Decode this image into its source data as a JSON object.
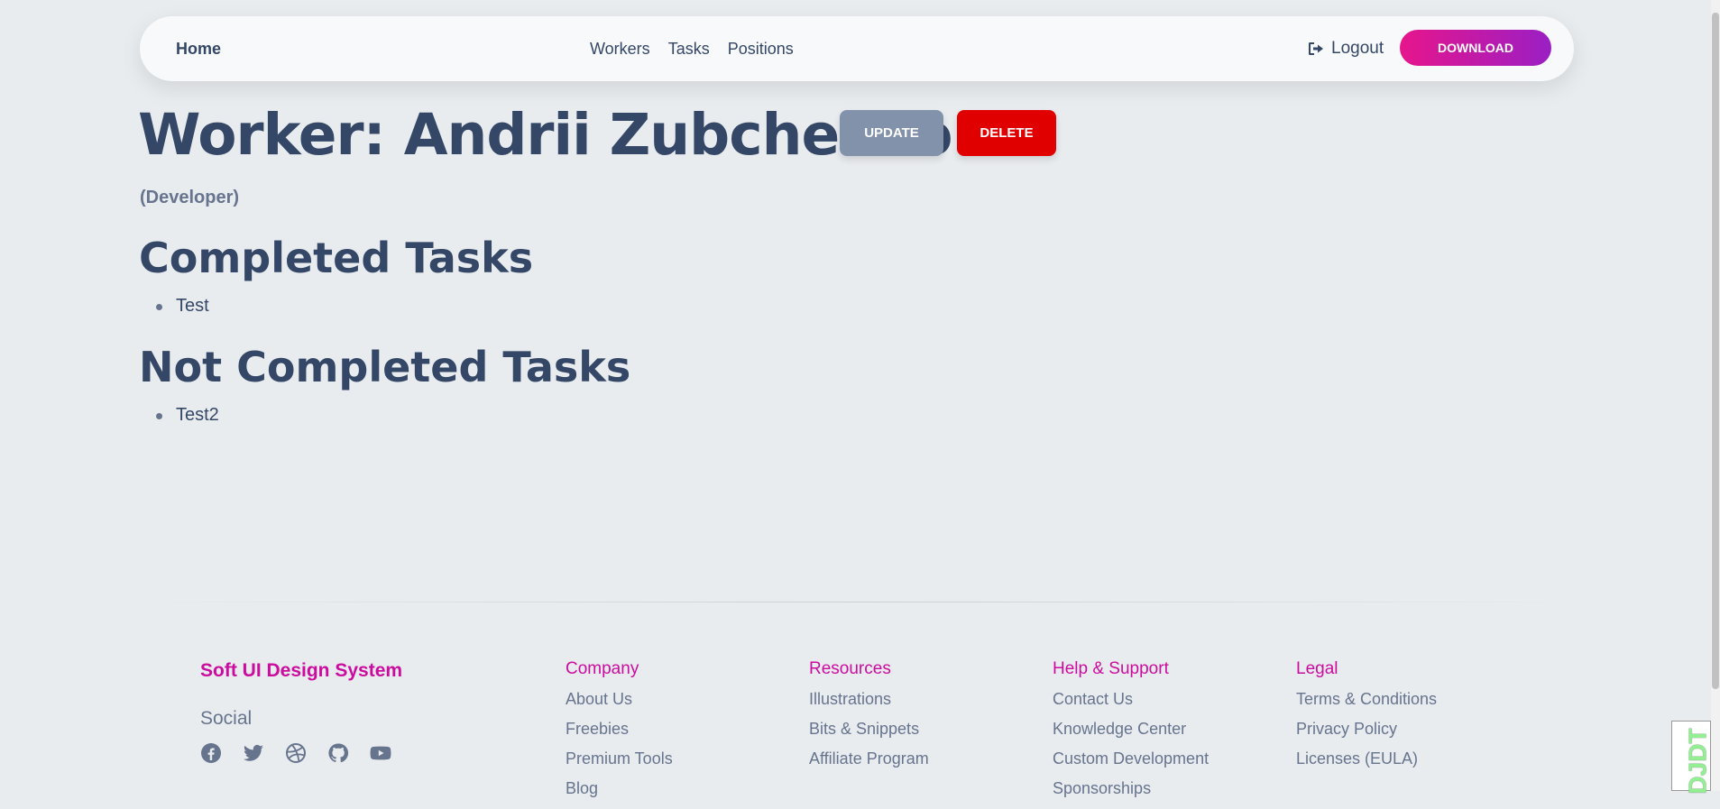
{
  "nav": {
    "brand": "Home",
    "links": [
      "Workers",
      "Tasks",
      "Positions"
    ],
    "logout": "Logout",
    "download": "DOWNLOAD"
  },
  "worker": {
    "title": "Worker: Andrii Zubchenko",
    "position": "(Developer)",
    "update_label": "UPDATE",
    "delete_label": "DELETE"
  },
  "completed": {
    "heading": "Completed Tasks",
    "tasks": [
      "Test"
    ]
  },
  "not_completed": {
    "heading": "Not Completed Tasks",
    "tasks": [
      "Test2"
    ]
  },
  "footer": {
    "brand": "Soft UI Design System",
    "social_title": "Social",
    "social_icons": [
      "facebook-icon",
      "twitter-icon",
      "dribbble-icon",
      "github-icon",
      "youtube-icon"
    ],
    "columns": [
      {
        "title": "Company",
        "links": [
          "About Us",
          "Freebies",
          "Premium Tools",
          "Blog"
        ]
      },
      {
        "title": "Resources",
        "links": [
          "Illustrations",
          "Bits & Snippets",
          "Affiliate Program"
        ]
      },
      {
        "title": "Help & Support",
        "links": [
          "Contact Us",
          "Knowledge Center",
          "Custom Development",
          "Sponsorships"
        ]
      },
      {
        "title": "Legal",
        "links": [
          "Terms & Conditions",
          "Privacy Policy",
          "Licenses (EULA)"
        ]
      }
    ]
  },
  "debug_toolbar": {
    "label": "DJDT"
  },
  "colors": {
    "primary": "#cb0c9f",
    "text": "#344767",
    "muted": "#67748e",
    "danger": "#e10000",
    "secondary": "#8392ab"
  }
}
